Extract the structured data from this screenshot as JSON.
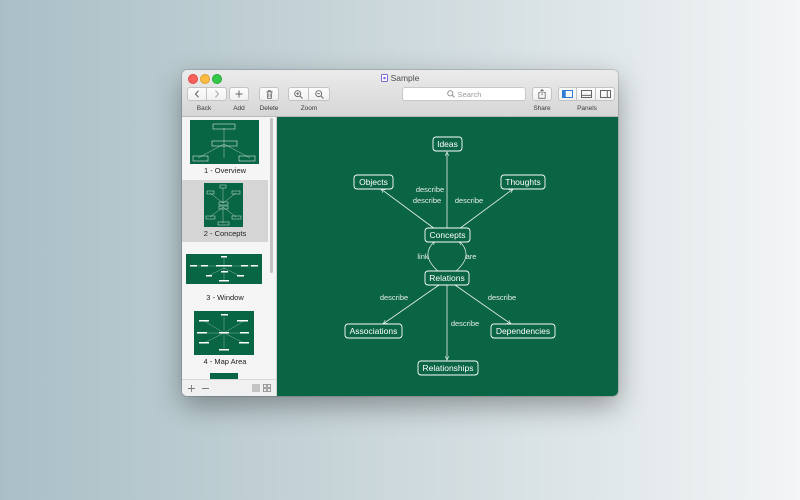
{
  "window": {
    "title": "Sample"
  },
  "toolbar": {
    "back_label": "Back",
    "add_label": "Add",
    "delete_label": "Delete",
    "zoom_label": "Zoom",
    "search_placeholder": "Search",
    "share_label": "Share",
    "panels_label": "Panels"
  },
  "sidebar": {
    "items": [
      {
        "label": "1 - Overview",
        "selected": false
      },
      {
        "label": "2 - Concepts",
        "selected": true
      },
      {
        "label": "3 - Window",
        "selected": false
      },
      {
        "label": "4 - Map Area",
        "selected": false
      }
    ],
    "footer": {
      "add_icon": "plus-icon",
      "remove_icon": "minus-icon",
      "list_icon": "list-view-icon",
      "grid_icon": "grid-view-icon"
    }
  },
  "map": {
    "background_color": "#0a6545",
    "nodes": {
      "ideas": "Ideas",
      "objects": "Objects",
      "thoughts": "Thoughts",
      "concepts": "Concepts",
      "relations": "Relations",
      "associations": "Associations",
      "dependencies": "Dependencies",
      "relationships": "Relationships"
    },
    "edge_labels": {
      "concepts_objects": "describe",
      "concepts_ideas": "describe",
      "concepts_thoughts": "describe",
      "loop_left": "link",
      "loop_right": "are",
      "relations_associations": "describe",
      "relations_relationships": "describe",
      "relations_dependencies": "describe"
    }
  }
}
